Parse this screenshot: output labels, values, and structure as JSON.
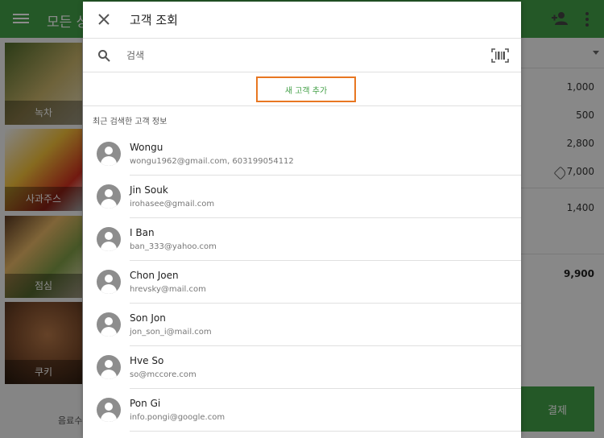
{
  "background": {
    "app_title": "모든 상",
    "tiles": [
      {
        "label": "녹차"
      },
      {
        "label": "사과주스"
      },
      {
        "label": "점심"
      },
      {
        "label": "쿠키"
      }
    ],
    "bottom_left_label": "음료수",
    "ticket": {
      "amounts": [
        "1,000",
        "500",
        "2,800",
        "7,000",
        "1,400"
      ],
      "total": "9,900",
      "pay_label": "결제"
    },
    "icons": {
      "menu": "menu-icon",
      "add_person": "add-person-icon",
      "more": "more-vert-icon",
      "tag": "tag-icon"
    }
  },
  "dialog": {
    "title": "고객 조회",
    "search": {
      "placeholder": "검색",
      "value": ""
    },
    "add_customer_label": "새 고객 추가",
    "recent_heading": "최근 검색한 고객 정보",
    "customers": [
      {
        "name": "Wongu",
        "detail": "wongu1962@gmail.com, 603199054112"
      },
      {
        "name": "Jin Souk",
        "detail": "irohasee@gmail.com"
      },
      {
        "name": "I Ban",
        "detail": "ban_333@yahoo.com"
      },
      {
        "name": "Chon Joen",
        "detail": "hrevsky@mail.com"
      },
      {
        "name": "Son Jon",
        "detail": "jon_son_i@mail.com"
      },
      {
        "name": "Hve So",
        "detail": "so@mccore.com"
      },
      {
        "name": "Pon Gi",
        "detail": "info.pongi@google.com"
      }
    ],
    "icons": {
      "close": "close-icon",
      "search": "search-icon",
      "barcode": "barcode-scan-icon",
      "avatar": "person-avatar-icon"
    }
  },
  "colors": {
    "brand_green": "#43a047",
    "highlight_orange": "#e87722",
    "avatar_gray": "#8d8d8d"
  }
}
